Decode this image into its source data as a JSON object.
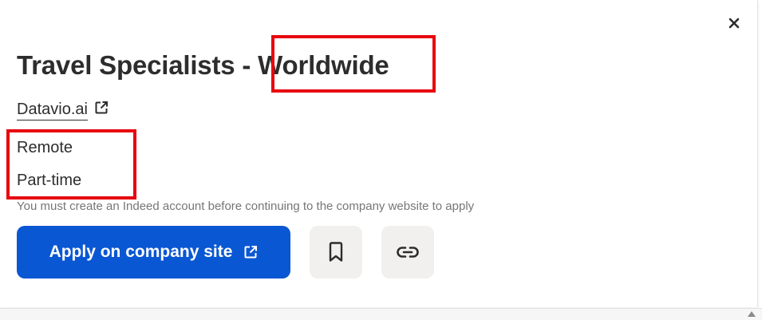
{
  "job": {
    "title": "Travel Specialists - Worldwide",
    "company": "Datavio.ai",
    "location": "Remote",
    "job_type": "Part-time",
    "notice": "You must create an Indeed account before continuing to the company website to apply"
  },
  "actions": {
    "apply_label": "Apply on company site",
    "close_icon": "close-icon",
    "save_icon": "bookmark-icon",
    "copy_icon": "link-icon"
  },
  "colors": {
    "primary": "#0a57d3",
    "text": "#2d2d2d",
    "muted": "#767676",
    "icon_button_bg": "#f1f0ef",
    "highlight": "#e8050f"
  }
}
